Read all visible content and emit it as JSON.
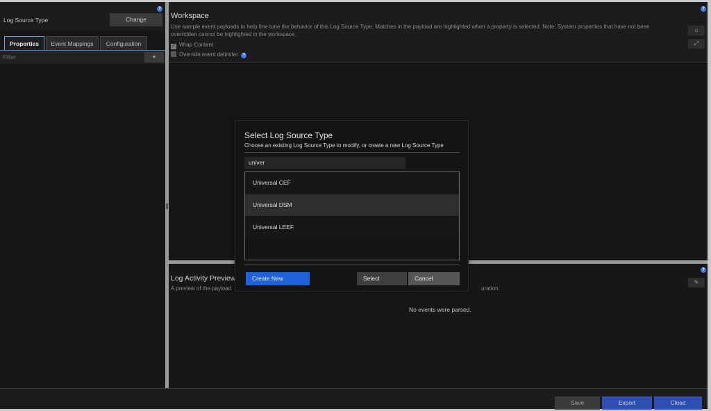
{
  "left_panel": {
    "log_source_label": "Log Source Type",
    "change_button": "Change",
    "tabs": [
      {
        "label": "Properties"
      },
      {
        "label": "Event Mappings"
      },
      {
        "label": "Configuration"
      }
    ],
    "filter_placeholder": "Filter",
    "add_button": "+"
  },
  "workspace": {
    "title": "Workspace",
    "description": "Use sample event payloads to help fine tune the behavior of this Log Source Type. Matches in the payload are highlighted when a property is selected. Note: System properties that have not been overridden cannot be highlighted in the workspace.",
    "wrap_content_label": "Wrap Content",
    "wrap_content_checked": true,
    "override_delimiter_label": "Override event delimiter",
    "override_delimiter_checked": false
  },
  "log_activity": {
    "title": "Log Activity Preview",
    "description_start": "A preview of the payload",
    "description_end": "uration.",
    "empty_message": "No events were parsed."
  },
  "footer": {
    "save_label": "Save",
    "export_label": "Export",
    "close_label": "Close"
  },
  "modal": {
    "title": "Select Log Source Type",
    "subtitle": "Choose an existing Log Source Type to modify, or create a new Log Source Type",
    "search_value": "univer",
    "items": [
      {
        "label": "Universal CEF"
      },
      {
        "label": "Universal DSM"
      },
      {
        "label": "Universal LEEF"
      }
    ],
    "selected_item": "Universal DSM",
    "create_new_label": "Create New",
    "select_label": "Select",
    "cancel_label": "Cancel"
  },
  "colors": {
    "primary_blue": "#1e61d8",
    "footer_blue": "#2e4fb0",
    "info_blue": "#3d7ae0"
  }
}
